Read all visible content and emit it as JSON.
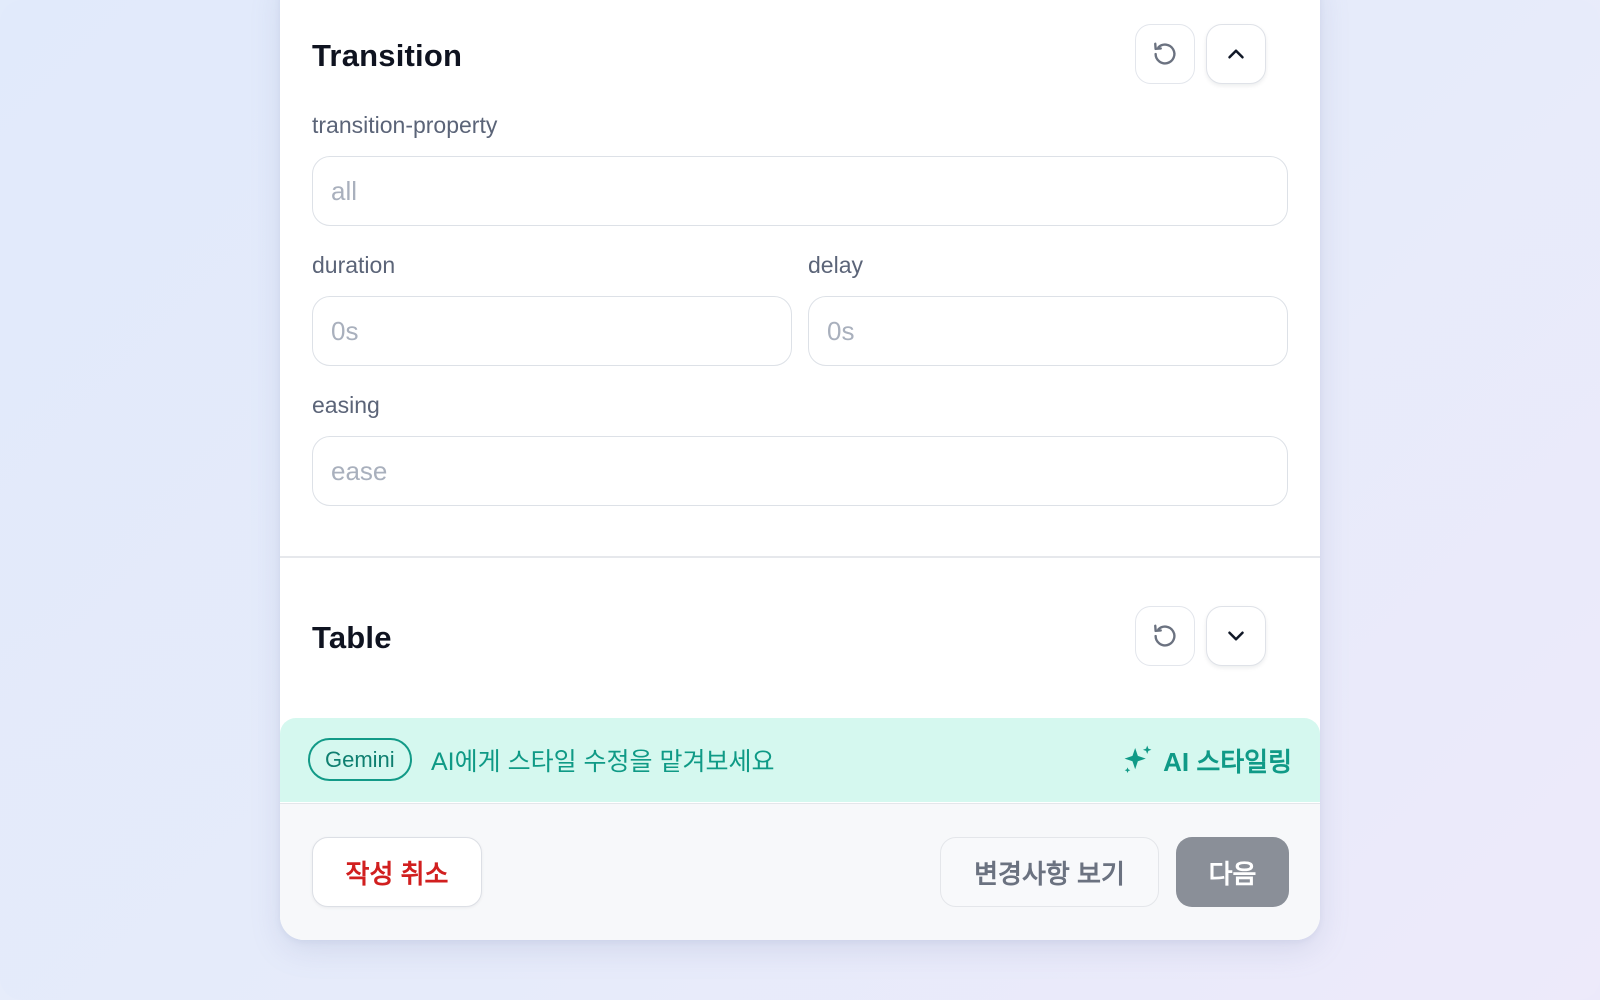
{
  "transition": {
    "title": "Transition",
    "property_label": "transition-property",
    "property_placeholder": "all",
    "property_value": "",
    "duration_label": "duration",
    "duration_placeholder": "0s",
    "duration_value": "",
    "delay_label": "delay",
    "delay_placeholder": "0s",
    "delay_value": "",
    "easing_label": "easing",
    "easing_placeholder": "ease",
    "easing_value": "",
    "reset_icon": "reset-icon",
    "toggle_icon": "chevron-up-icon"
  },
  "table": {
    "title": "Table",
    "reset_icon": "reset-icon",
    "toggle_icon": "chevron-down-icon"
  },
  "ai_bar": {
    "badge": "Gemini",
    "prompt": "AI에게 스타일 수정을 맡겨보세요",
    "action_label": "AI 스타일링",
    "action_icon": "sparkle-icon",
    "accent": "#109a87",
    "background": "#d5f8ef"
  },
  "footer": {
    "cancel_label": "작성 취소",
    "view_changes_label": "변경사항 보기",
    "next_label": "다음"
  },
  "colors": {
    "danger": "#d11f1f",
    "next_button_bg": "#8a8f98"
  }
}
